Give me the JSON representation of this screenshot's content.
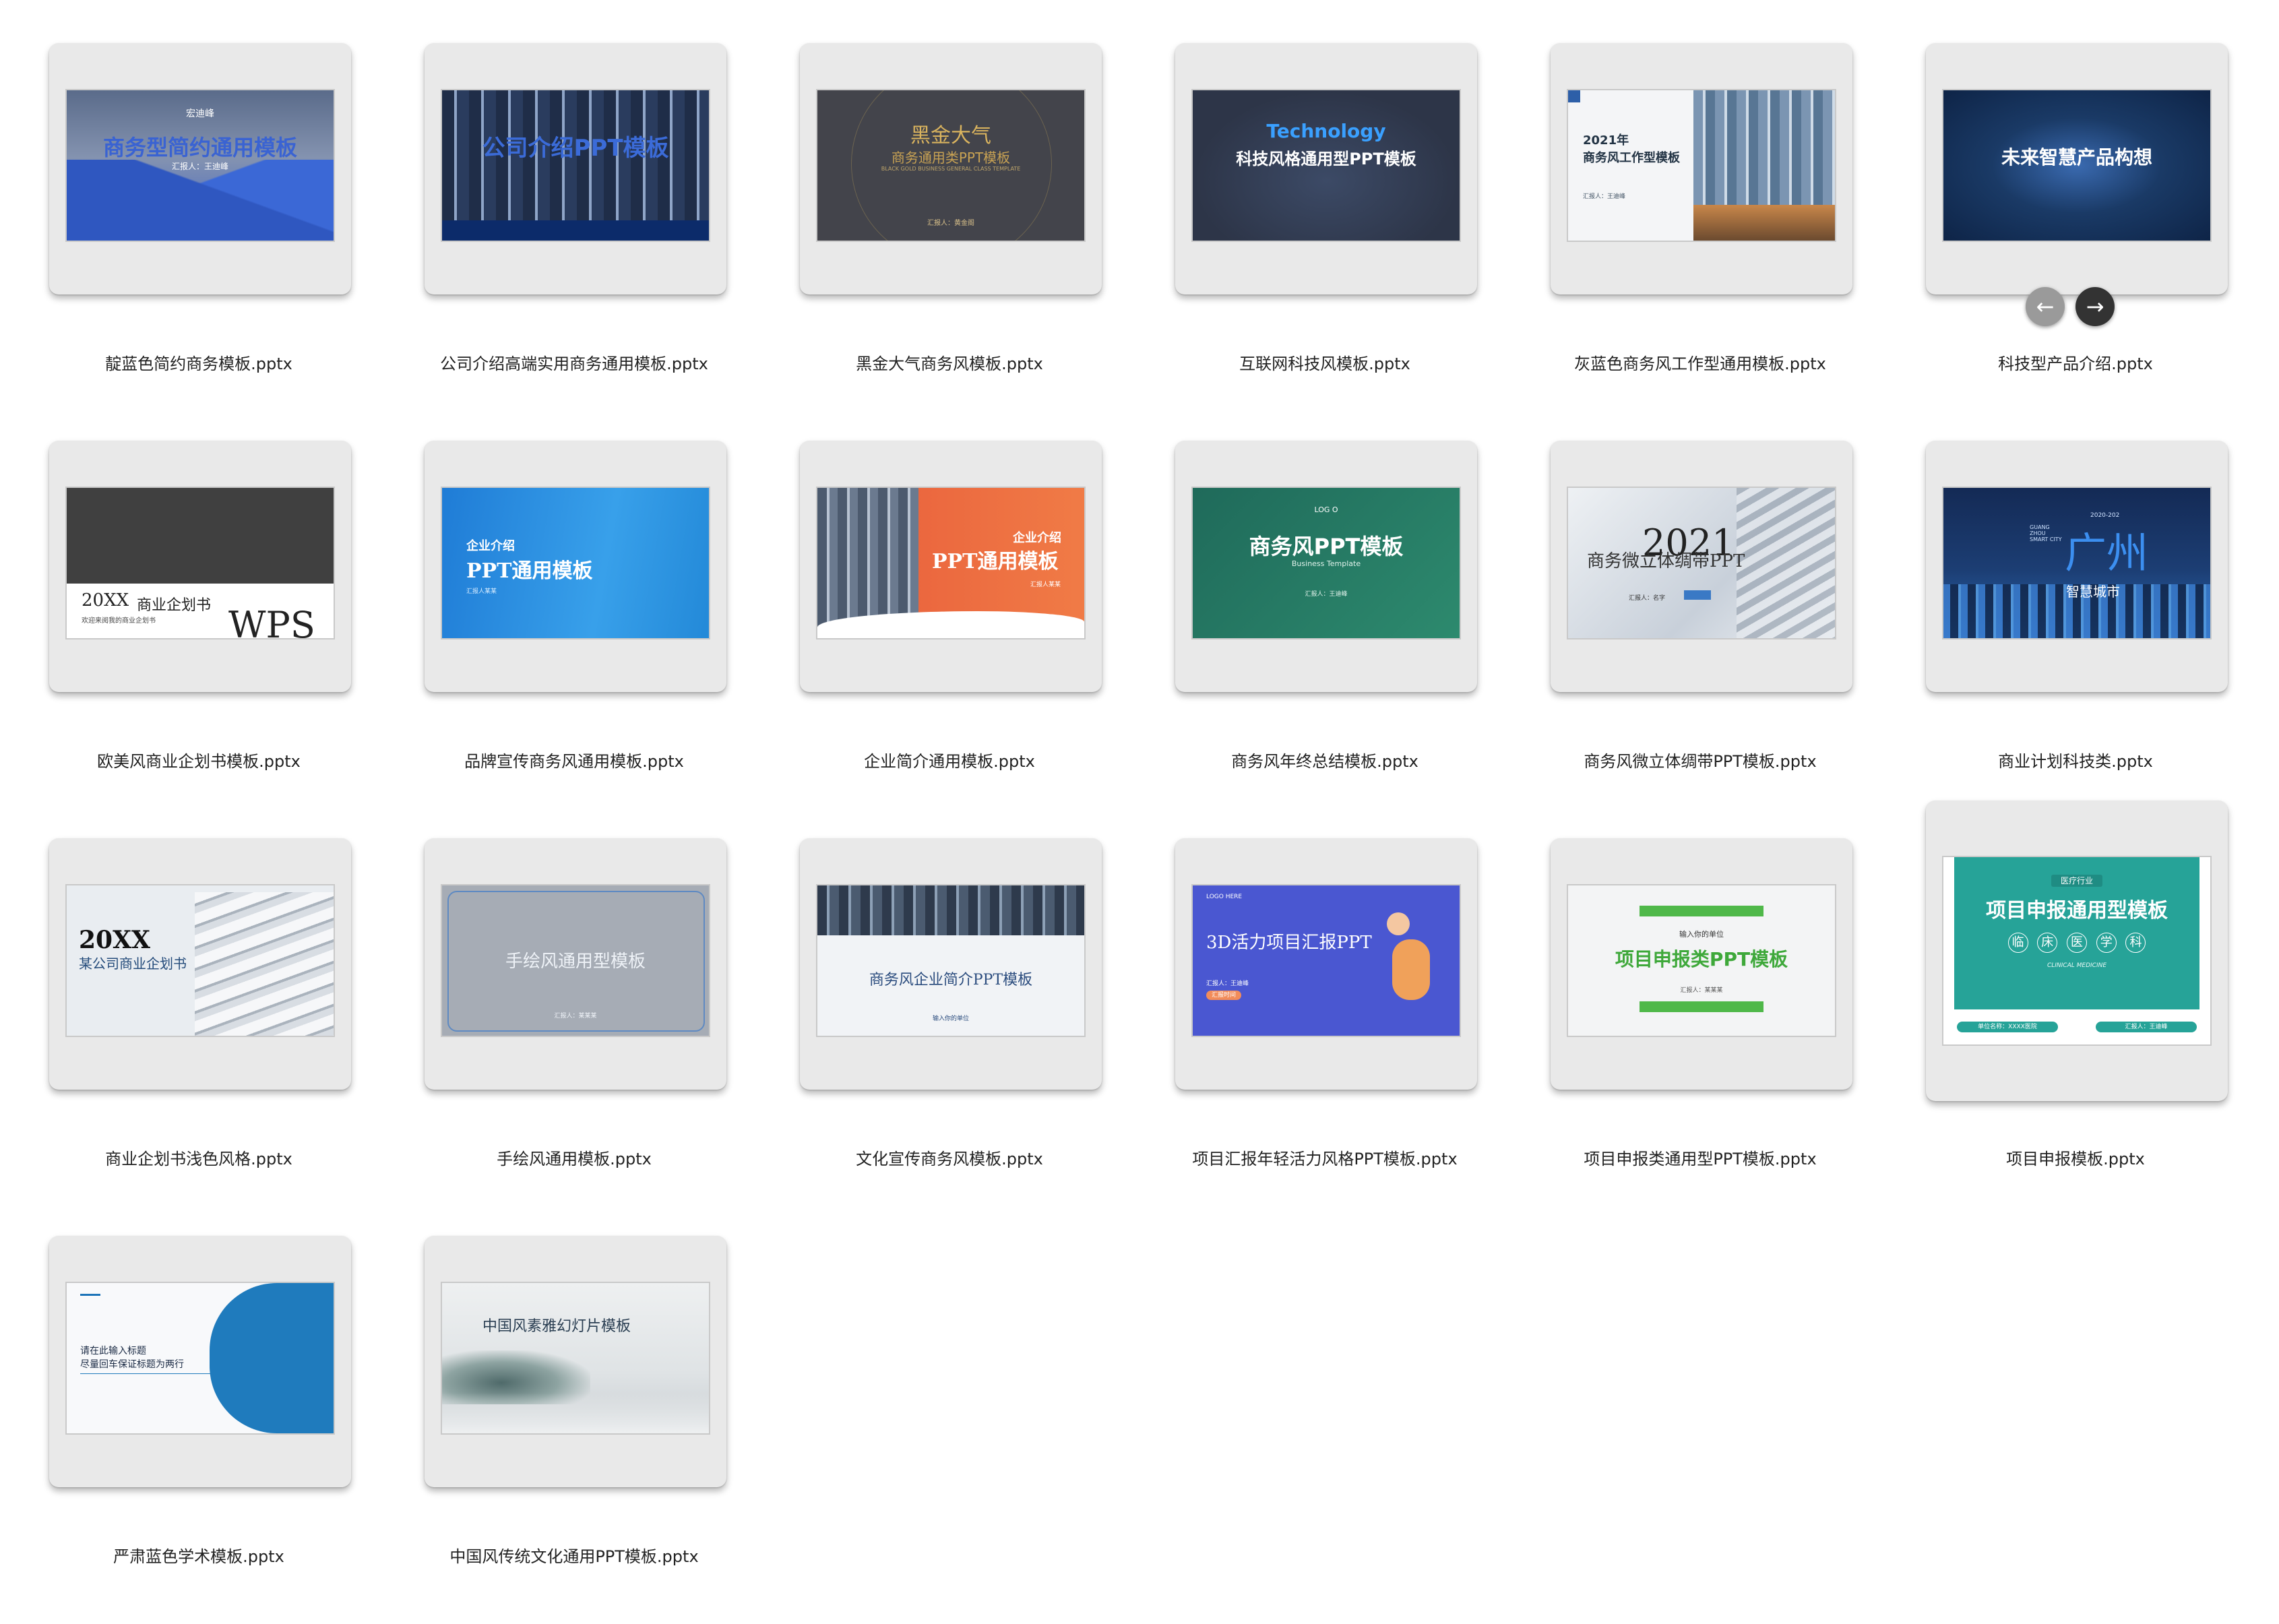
{
  "files": [
    {
      "name": "靛蓝色简约商务模板.pptx",
      "title": "商务型简约通用模板",
      "logo": "宏迪峰",
      "sub": "汇报人：王迪峰"
    },
    {
      "name": "公司介绍高端实用商务通用模板.pptx",
      "title": "公司介绍PPT模板"
    },
    {
      "name": "黑金大气商务风模板.pptx",
      "title": "黑金大气",
      "subtitle": "商务通用类PPT模板",
      "en": "BLACK GOLD BUSINESS GENERAL CLASS TEMPLATE",
      "reporter": "汇报人：黄金阁"
    },
    {
      "name": "互联网科技风模板.pptx",
      "en": "Technology",
      "title": "科技风格通用型PPT模板"
    },
    {
      "name": "灰蓝色商务风工作型通用模板.pptx",
      "year": "2021年",
      "title": "商务风工作型模板",
      "sub": "汇报人：王迪峰"
    },
    {
      "name": "科技型产品介绍.pptx",
      "title": "未来智慧产品构想"
    },
    {
      "name": "欧美风商业企划书模板.pptx",
      "year": "20XX",
      "title": "商业企划书",
      "sub": "欢迎来阅我的商业企划书",
      "brand": "WPS"
    },
    {
      "name": "品牌宣传商务风通用模板.pptx",
      "kicker": "企业介绍",
      "title": "PPT通用模板",
      "sub": "汇报人某某"
    },
    {
      "name": "企业简介通用模板.pptx",
      "kicker": "企业介绍",
      "title": "PPT通用模板",
      "sub": "汇报人某某"
    },
    {
      "name": "商务风年终总结模板.pptx",
      "logo": "LOG O",
      "title": "商务风PPT模板",
      "en": "Business Template",
      "sub": "汇报人：王迪峰"
    },
    {
      "name": "商务风微立体绸带PPT模板.pptx",
      "year": "2021",
      "title": "商务微立体绸带PPT",
      "sub": "汇报人：名字"
    },
    {
      "name": "商业计划科技类.pptx",
      "city": "广州",
      "pinyin": "GUANG ZHOU SMART CITY",
      "years": "2020-202",
      "title": "智慧城市"
    },
    {
      "name": "商业企划书浅色风格.pptx",
      "year": "20XX",
      "title": "某公司商业企划书"
    },
    {
      "name": "手绘风通用模板.pptx",
      "title": "手绘风通用型模板",
      "sub": "汇报人：某某某"
    },
    {
      "name": "文化宣传商务风模板.pptx",
      "title": "商务风企业简介PPT模板",
      "sub": "输入你的单位"
    },
    {
      "name": "项目汇报年轻活力风格PPT模板.pptx",
      "logo": "LOGO HERE",
      "title": "3D活力项目汇报PPT",
      "sub": "汇报人：王迪峰",
      "btn": "汇报时间"
    },
    {
      "name": "项目申报类通用型PPT模板.pptx",
      "unit": "输入你的单位",
      "title": "项目申报类PPT模板",
      "sub": "汇报人：某某某"
    },
    {
      "name": "项目申报模板.pptx",
      "tag": "医疗行业",
      "title": "项目申报通用型模板",
      "chars": [
        "临",
        "床",
        "医",
        "学",
        "科"
      ],
      "en": "CLINICAL MEDICINE",
      "left": "单位名称：XXXX医院",
      "right": "汇报人：王迪峰"
    },
    {
      "name": "严肃蓝色学术模板.pptx",
      "title1": "请在此输入标题",
      "title2": "尽量回车保证标题为两行"
    },
    {
      "name": "中国风传统文化通用PPT模板.pptx",
      "title": "中国风素雅幻灯片模板"
    }
  ],
  "nav": {
    "prev": "arrow-left-icon",
    "next": "arrow-right-icon"
  }
}
